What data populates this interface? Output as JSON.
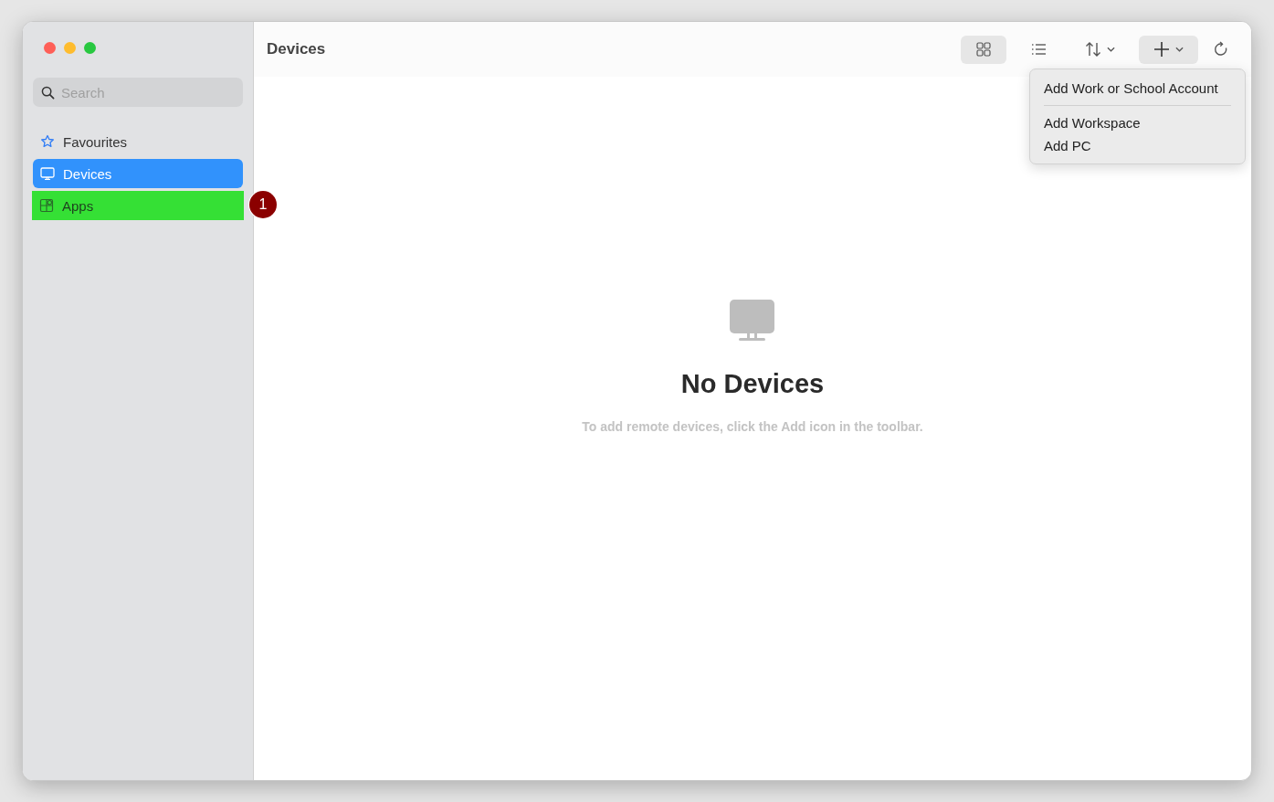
{
  "window": {
    "title": "Devices"
  },
  "search": {
    "placeholder": "Search"
  },
  "sidebar": {
    "items": [
      {
        "label": "Favourites",
        "selected": false,
        "highlighted": false
      },
      {
        "label": "Devices",
        "selected": true,
        "highlighted": false
      },
      {
        "label": "Apps",
        "selected": false,
        "highlighted": true,
        "marker": "1"
      }
    ]
  },
  "toolbar": [
    {
      "kind": "grid",
      "pressed": true,
      "dropdown": false
    },
    {
      "kind": "list",
      "pressed": false,
      "dropdown": false
    },
    {
      "kind": "sort",
      "pressed": false,
      "dropdown": true
    },
    {
      "kind": "add",
      "pressed": true,
      "dropdown": true
    },
    {
      "kind": "refresh",
      "pressed": false,
      "dropdown": false
    }
  ],
  "add_menu": {
    "items": [
      {
        "label": "Add Work or School Account",
        "divider_after": true
      },
      {
        "label": "Add Workspace",
        "divider_after": false
      },
      {
        "label": "Add PC",
        "divider_after": false
      }
    ]
  },
  "empty_state": {
    "title": "No Devices",
    "message": "To add remote devices, click the Add icon in the toolbar."
  }
}
